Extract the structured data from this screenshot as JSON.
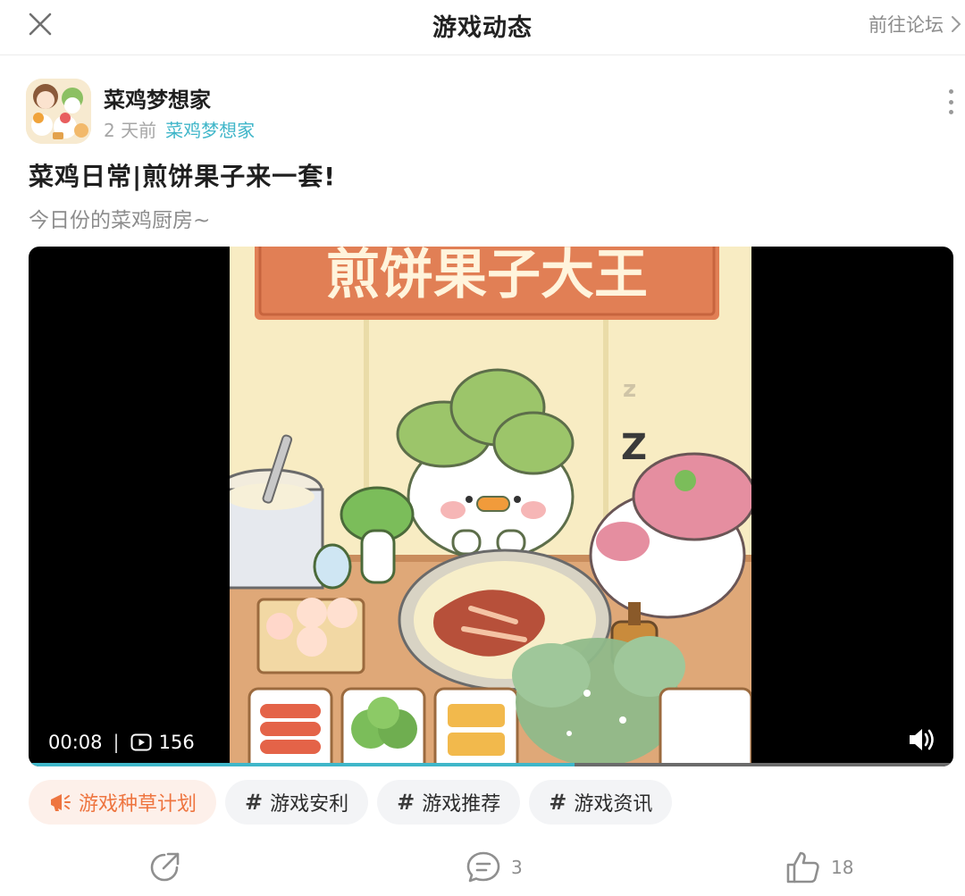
{
  "topbar": {
    "title": "游戏动态",
    "forum_link": "前往论坛",
    "close_icon": "close-icon",
    "chevron_icon": "chevron-right-icon"
  },
  "post": {
    "author": "菜鸡梦想家",
    "time_ago": "2 天前",
    "circle": "菜鸡梦想家",
    "title": "菜鸡日常|煎饼果子来一套!",
    "subtitle": "今日份的菜鸡厨房~"
  },
  "video": {
    "banner_text": "煎饼果子大王",
    "current_time": "00:08",
    "separator": "|",
    "play_count": "156",
    "progress": 0.59,
    "accent_color": "#3fb6c9"
  },
  "tags": [
    {
      "label": "游戏种草计划",
      "icon": "megaphone-icon",
      "primary": true
    },
    {
      "label": "游戏安利",
      "icon": "hashtag-icon",
      "primary": false
    },
    {
      "label": "游戏推荐",
      "icon": "hashtag-icon",
      "primary": false
    },
    {
      "label": "游戏资讯",
      "icon": "hashtag-icon",
      "primary": false
    }
  ],
  "actions": {
    "share_icon": "share-icon",
    "comment_count": "3",
    "like_count": "18"
  }
}
